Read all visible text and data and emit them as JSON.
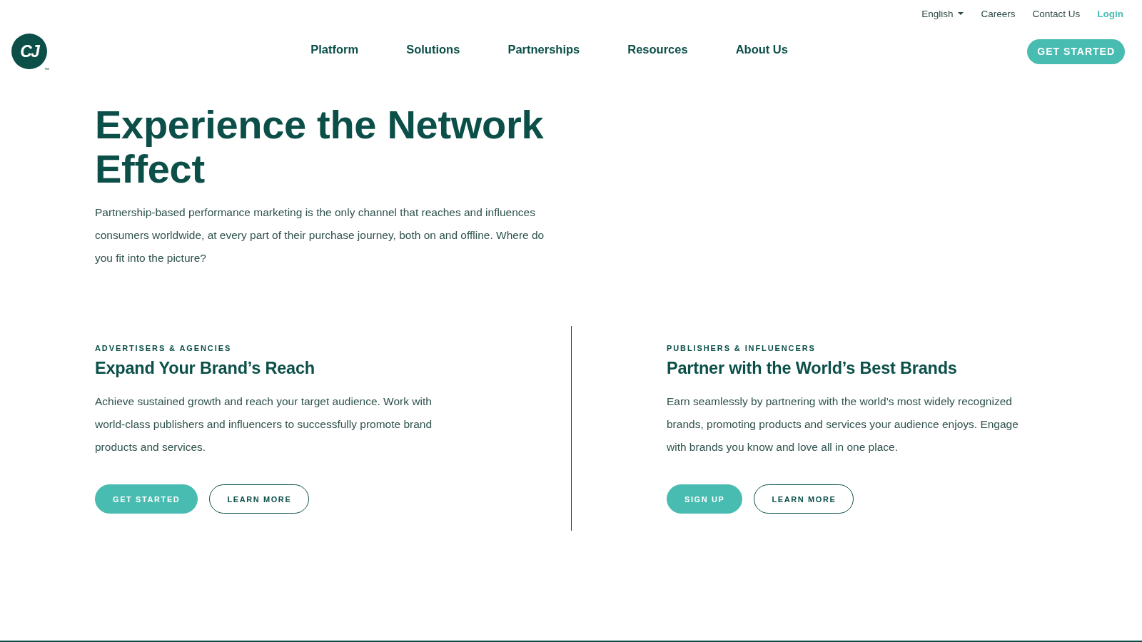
{
  "utility_nav": [
    {
      "label": "English",
      "kind": "dropdown"
    },
    {
      "label": "Careers",
      "kind": "link"
    },
    {
      "label": "Contact Us",
      "kind": "link"
    },
    {
      "label": "Login",
      "kind": "login"
    }
  ],
  "logo": {
    "text": "CJ",
    "trademark": "™"
  },
  "main_nav": [
    {
      "label": "Platform"
    },
    {
      "label": "Solutions"
    },
    {
      "label": "Partnerships"
    },
    {
      "label": "Resources"
    },
    {
      "label": "About Us"
    }
  ],
  "header_button": {
    "label": "GET STARTED"
  },
  "hero": {
    "title": "Experience the Network Effect",
    "body": "Partnership-based performance marketing is the only channel that reaches and influences consumers worldwide, at every part of their purchase journey, both on and offline. Where do you fit into the picture?"
  },
  "audiences": [
    {
      "eyebrow": "ADVERTISERS & AGENCIES",
      "heading": "Expand Your Brand’s Reach",
      "body": "Achieve sustained growth and reach your target audience. Work with world-class publishers and influencers to successfully promote brand products and services.",
      "buttons": [
        {
          "label": "GET STARTED",
          "kind": "primary"
        },
        {
          "label": "LEARN MORE",
          "kind": "outline"
        }
      ]
    },
    {
      "eyebrow": "PUBLISHERS & INFLUENCERS",
      "heading": "Partner with the World’s Best Brands",
      "body": "Earn seamlessly by partnering with the world’s most widely recognized brands, promoting products and services your audience enjoys. Engage with brands you know and love all in one place.",
      "buttons": [
        {
          "label": "SIGN UP",
          "kind": "primary"
        },
        {
          "label": "LEARN MORE",
          "kind": "outline"
        }
      ]
    }
  ]
}
